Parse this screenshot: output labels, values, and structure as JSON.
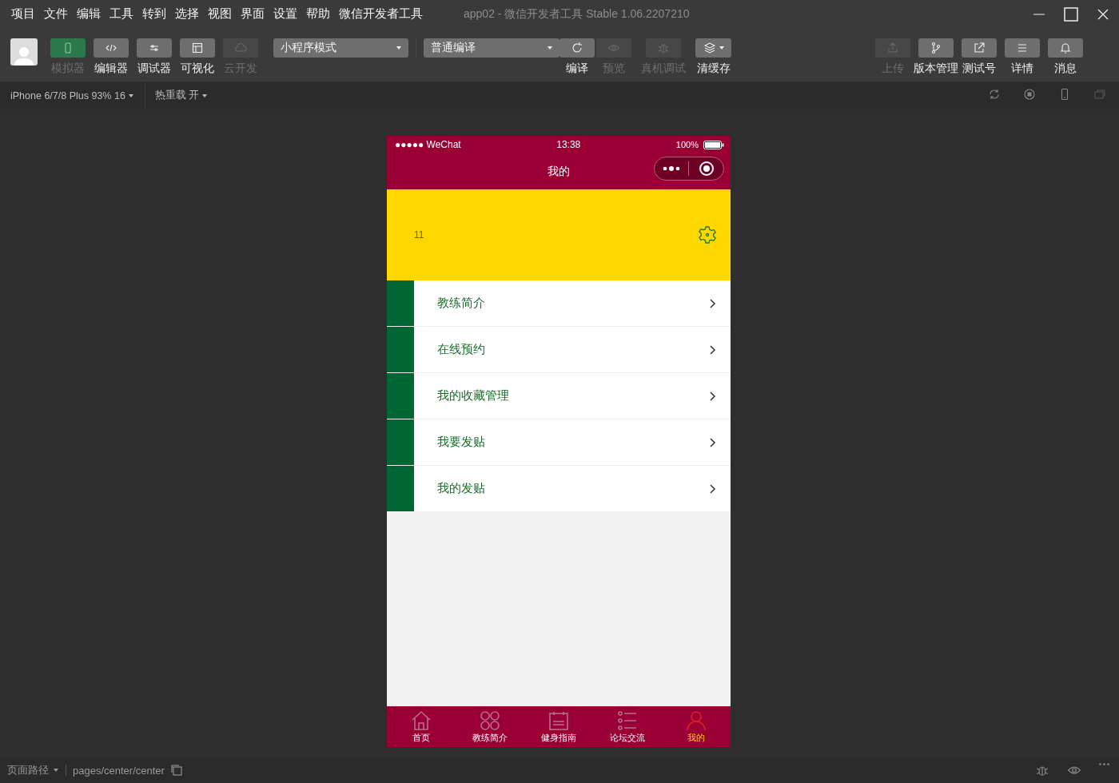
{
  "menu_bar": [
    "项目",
    "文件",
    "编辑",
    "工具",
    "转到",
    "选择",
    "视图",
    "界面",
    "设置",
    "帮助",
    "微信开发者工具"
  ],
  "window": {
    "title": "app02 - 微信开发者工具 Stable 1.06.2207210"
  },
  "toolbar": {
    "view_tools": [
      {
        "label": "模拟器",
        "active": true,
        "disabled": false
      },
      {
        "label": "编辑器",
        "active": false,
        "disabled": false
      },
      {
        "label": "调试器",
        "active": false,
        "disabled": false
      },
      {
        "label": "可视化",
        "active": false,
        "disabled": false
      },
      {
        "label": "云开发",
        "active": false,
        "disabled": true
      }
    ],
    "mode_select": "小程序模式",
    "compile_select": "普通编译",
    "compile_tools": [
      {
        "label": "编译",
        "disabled": false
      },
      {
        "label": "预览",
        "disabled": true
      },
      {
        "label": "真机调试",
        "disabled": true
      },
      {
        "label": "清缓存",
        "disabled": false
      }
    ],
    "right_tools": [
      {
        "label": "上传",
        "disabled": true
      },
      {
        "label": "版本管理",
        "disabled": false
      },
      {
        "label": "测试号",
        "disabled": false
      },
      {
        "label": "详情",
        "disabled": false
      },
      {
        "label": "消息",
        "disabled": false
      }
    ]
  },
  "sub_bar": {
    "device": "iPhone 6/7/8 Plus 93% 16",
    "hot_reload": "热重载 开"
  },
  "phone": {
    "status": {
      "carrier": "●●●●● WeChat",
      "time": "13:38",
      "battery": "100%"
    },
    "nav_title": "我的",
    "header": {
      "text": "11"
    },
    "menu": [
      "教练简介",
      "在线预约",
      "我的收藏管理",
      "我要发贴",
      "我的发贴"
    ],
    "tabs": [
      {
        "label": "首页",
        "selected": false
      },
      {
        "label": "教练简介",
        "selected": false
      },
      {
        "label": "健身指南",
        "selected": false
      },
      {
        "label": "论坛交流",
        "selected": false
      },
      {
        "label": "我的",
        "selected": true
      }
    ]
  },
  "status_bar": {
    "path_label": "页面路径",
    "path": "pages/center/center"
  }
}
